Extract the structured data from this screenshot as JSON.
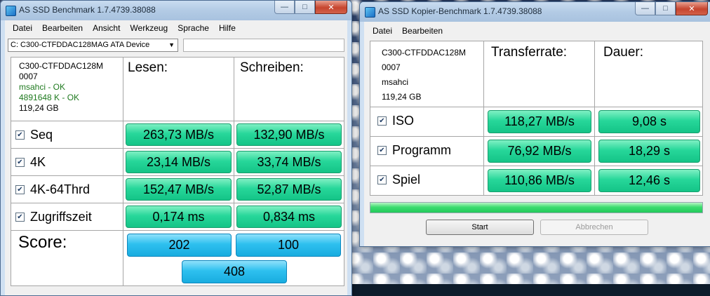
{
  "window1": {
    "title": "AS SSD Benchmark 1.7.4739.38088",
    "menu": [
      "Datei",
      "Bearbeiten",
      "Ansicht",
      "Werkzeug",
      "Sprache",
      "Hilfe"
    ],
    "drive_select": "C: C300-CTFDDAC128MAG ATA Device",
    "drive_path": "",
    "info": {
      "model": "C300-CTFDDAC128M",
      "firmware": "0007",
      "driver": "msahci - OK",
      "alignment": "4891648 K - OK",
      "size": "119,24 GB"
    },
    "headers": {
      "read": "Lesen:",
      "write": "Schreiben:"
    },
    "rows": [
      {
        "label": "Seq",
        "read": "263,73 MB/s",
        "write": "132,90 MB/s"
      },
      {
        "label": "4K",
        "read": "23,14 MB/s",
        "write": "33,74 MB/s"
      },
      {
        "label": "4K-64Thrd",
        "read": "152,47 MB/s",
        "write": "52,87 MB/s"
      },
      {
        "label": "Zugriffszeit",
        "read": "0,174 ms",
        "write": "0,834 ms"
      }
    ],
    "score": {
      "label": "Score:",
      "read": "202",
      "write": "100",
      "total": "408"
    }
  },
  "window2": {
    "title": "AS SSD Kopier-Benchmark 1.7.4739.38088",
    "menu": [
      "Datei",
      "Bearbeiten"
    ],
    "info": {
      "model": "C300-CTFDDAC128M",
      "firmware": "0007",
      "driver": "msahci",
      "size": "119,24 GB"
    },
    "headers": {
      "rate": "Transferrate:",
      "duration": "Dauer:"
    },
    "rows": [
      {
        "label": "ISO",
        "rate": "118,27 MB/s",
        "duration": "9,08 s"
      },
      {
        "label": "Programm",
        "rate": "76,92 MB/s",
        "duration": "18,29 s"
      },
      {
        "label": "Spiel",
        "rate": "110,86 MB/s",
        "duration": "12,46 s"
      }
    ],
    "progress": 1.0,
    "buttons": {
      "start": "Start",
      "cancel": "Abbrechen"
    }
  },
  "colors": {
    "value_green": "#27d79a",
    "score_blue": "#2ec0ef",
    "progress_green": "#2ad46a",
    "ok_green": "#1f7a1f"
  }
}
